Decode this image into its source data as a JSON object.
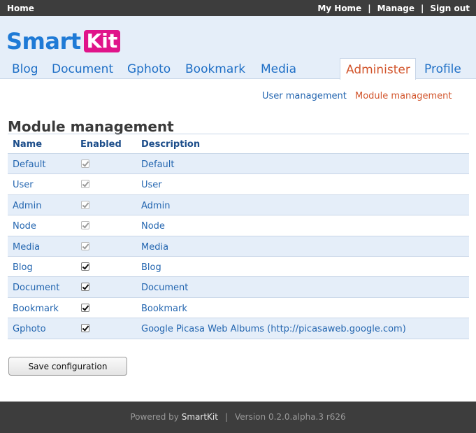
{
  "topbar": {
    "home": "Home",
    "links": [
      "My Home",
      "Manage",
      "Sign out"
    ],
    "separator": "|"
  },
  "logo": {
    "part1": "Smart",
    "part2": "Kit"
  },
  "nav": {
    "items": [
      "Blog",
      "Document",
      "Gphoto",
      "Bookmark",
      "Media"
    ],
    "active": "Administer",
    "profile": "Profile"
  },
  "subnav": {
    "user_management": "User management",
    "module_management": "Module management"
  },
  "page": {
    "title": "Module management"
  },
  "table": {
    "headers": [
      "Name",
      "Enabled",
      "Description"
    ],
    "rows": [
      {
        "name": "Default",
        "enabled": true,
        "locked": true,
        "description": "Default"
      },
      {
        "name": "User",
        "enabled": true,
        "locked": true,
        "description": "User"
      },
      {
        "name": "Admin",
        "enabled": true,
        "locked": true,
        "description": "Admin"
      },
      {
        "name": "Node",
        "enabled": true,
        "locked": true,
        "description": "Node"
      },
      {
        "name": "Media",
        "enabled": true,
        "locked": true,
        "description": "Media"
      },
      {
        "name": "Blog",
        "enabled": true,
        "locked": false,
        "description": "Blog"
      },
      {
        "name": "Document",
        "enabled": true,
        "locked": false,
        "description": "Document"
      },
      {
        "name": "Bookmark",
        "enabled": true,
        "locked": false,
        "description": "Bookmark"
      },
      {
        "name": "Gphoto",
        "enabled": true,
        "locked": false,
        "description": "Google Picasa Web Albums (http://picasaweb.google.com)"
      }
    ]
  },
  "save_button": "Save configuration",
  "footer": {
    "powered_by": "Powered by",
    "brand": "SmartKit",
    "separator": "|",
    "version": "Version 0.2.0.alpha.3 r626"
  },
  "colors": {
    "accent": "#1f7ad6",
    "brand_pink": "#e0148a",
    "active_tab": "#d2552c",
    "row_alt": "#e5eef9",
    "bar": "#3d3d3d"
  }
}
